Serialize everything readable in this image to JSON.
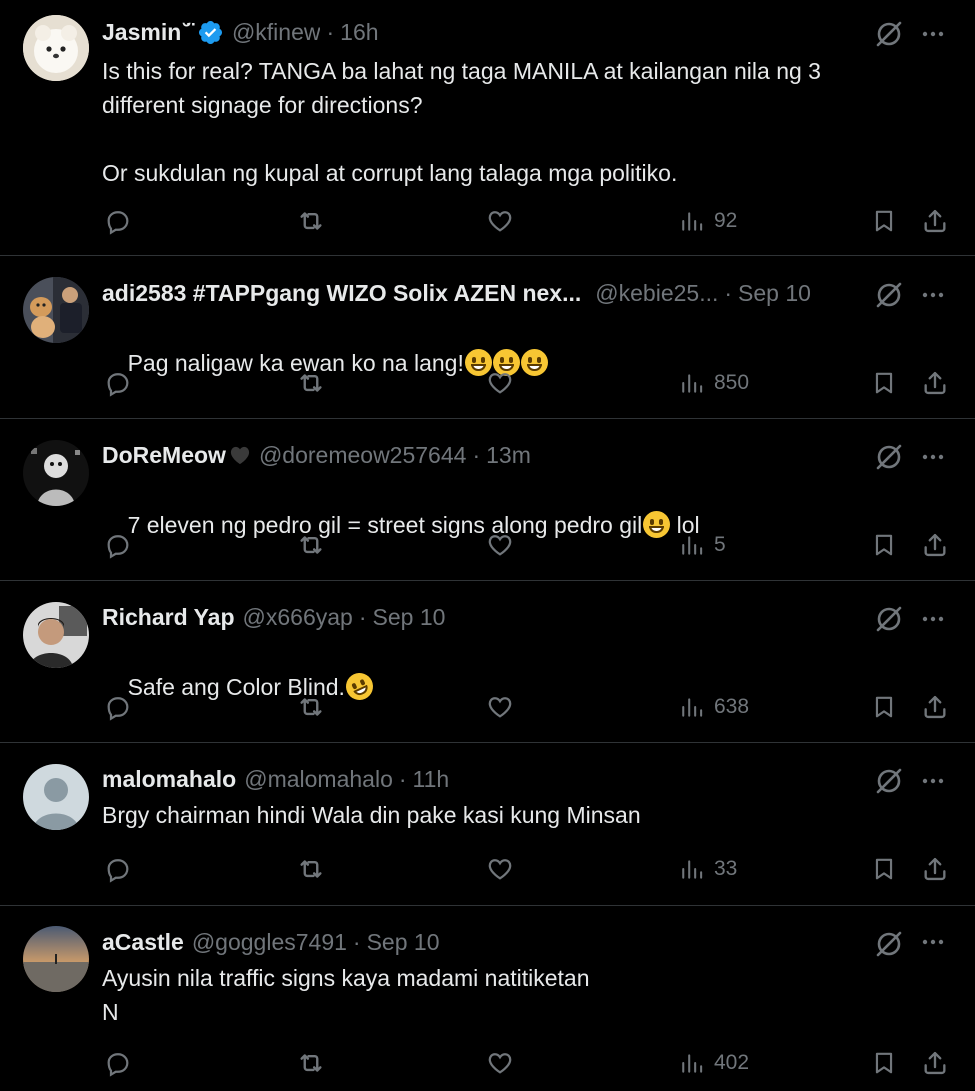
{
  "tweets": [
    {
      "name": "Jasmin",
      "name_suffix": "˘̈",
      "verified": true,
      "handle": "@kfinew",
      "time": "16h",
      "body": "Is this for real? TANGA ba lahat ng taga MANILA at kailangan nila ng 3\ndifferent signage for directions?\n\nOr sukdulan ng kupal at corrupt lang talaga mga politiko.",
      "views": "92",
      "avatar": "dog"
    },
    {
      "name": "adi2583 #TAPPgang WIZO Solix AZEN nex...",
      "handle": "@kebie25...",
      "time": "Sep 10",
      "body": "Pag naligaw ka ewan ko na lang!",
      "emojis": [
        "grinning-face",
        "grinning-face",
        "grinning-face"
      ],
      "views": "850",
      "avatar": "dogs-and-man"
    },
    {
      "name": "DoReMeow",
      "name_emoji": "black-heart",
      "handle": "@doremeow257644",
      "time": "13m",
      "body": "7 eleven ng pedro gil = street signs along pedro gil",
      "body_emoji": "face-with-tears-of-joy",
      "body_after": " lol",
      "views": "5",
      "avatar": "bw-art"
    },
    {
      "name": "Richard Yap",
      "handle": "@x666yap",
      "time": "Sep 10",
      "body": "Safe ang Color Blind.",
      "body_emoji": "rolling-on-floor-laughing",
      "views": "638",
      "avatar": "portrait"
    },
    {
      "name": "malomahalo",
      "handle": "@malomahalo",
      "time": "11h",
      "body": "Brgy chairman hindi Wala din pake kasi kung Minsan",
      "views": "33",
      "avatar": "default"
    },
    {
      "name": "aCastle",
      "handle": "@goggles7491",
      "time": "Sep 10",
      "body": "Ayusin nila traffic signs kaya madami natitiketan\nN",
      "views": "402",
      "avatar": "sunset"
    }
  ],
  "icons": {
    "reply": "reply-icon",
    "retweet": "retweet-icon",
    "like": "heart-icon",
    "views": "views-icon",
    "bookmark": "bookmark-icon",
    "share": "share-icon",
    "grok": "grok-icon",
    "more": "more-icon"
  },
  "colors": {
    "background": "#000000",
    "text": "#e7e9ea",
    "secondary": "#71767b",
    "divider": "#2f3336",
    "verified": "#1d9bf0"
  }
}
